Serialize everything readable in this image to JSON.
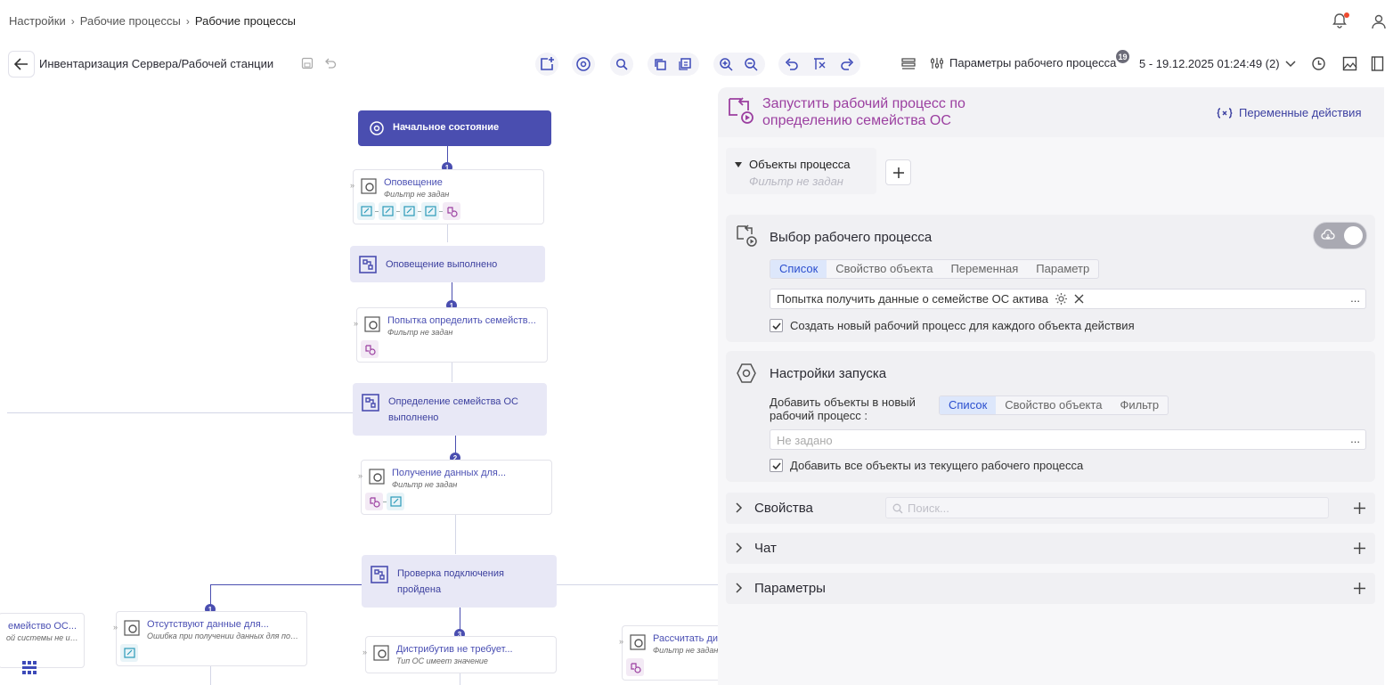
{
  "breadcrumbs": [
    "Настройки",
    "Рабочие процессы",
    "Рабочие процессы"
  ],
  "toolbar": {
    "workflow_title": "Инвентаризация Сервера/Рабочей станции",
    "params_label": "Параметры рабочего процесса",
    "params_badge": "19",
    "version": "5 - 19.12.2025 01:24:49 (2)"
  },
  "canvas": {
    "start": "Начальное состояние",
    "n1_title": "Оповещение",
    "n1_sub": "Фильтр не задан",
    "s1": "Оповещение выполнено",
    "n2_title": "Попытка определить семейств...",
    "n2_sub": "Фильтр не задан",
    "s2": "Определение семейства ОС выполнено",
    "n3_title": "Получение данных для...",
    "n3_sub": "Фильтр не задан",
    "s3": "Проверка подключения пройдена",
    "n4_title": "емейство ОС...",
    "n4_sub": "ой системы не име...",
    "n5_title": "Отсутствуют данные для...",
    "n5_sub": "Ошибка при получении данных для подкл...",
    "n6_title": "Дистрибутив не требует...",
    "n6_sub": "Тип ОС имеет значение",
    "n7_title": "Рассчитать дистрибутив сетки",
    "n7_sub": "Фильтр не задан",
    "nums": [
      "1",
      "1",
      "2",
      "1",
      "3"
    ]
  },
  "panel": {
    "title": "Запустить рабочий процесс по определению семейства ОС",
    "vars_label": "Переменные действия",
    "objects_title": "Объекты процесса",
    "objects_filter": "Фильтр не задан",
    "choose": {
      "title": "Выбор рабочего процесса",
      "tabs": [
        "Список",
        "Свойство объекта",
        "Переменная",
        "Параметр"
      ],
      "value": "Попытка получить данные о семействе ОС актива",
      "checkbox": "Создать новый рабочий процесс для каждого объекта действия"
    },
    "launch": {
      "title": "Настройки запуска",
      "add_label": "Добавить объекты в новый рабочий процесс :",
      "tabs": [
        "Список",
        "Свойство объекта",
        "Фильтр"
      ],
      "placeholder": "Не задано",
      "checkbox": "Добавить все объекты из текущего рабочего процесса"
    },
    "props": "Свойства",
    "search_placeholder": "Поиск...",
    "chat": "Чат",
    "params": "Параметры"
  }
}
